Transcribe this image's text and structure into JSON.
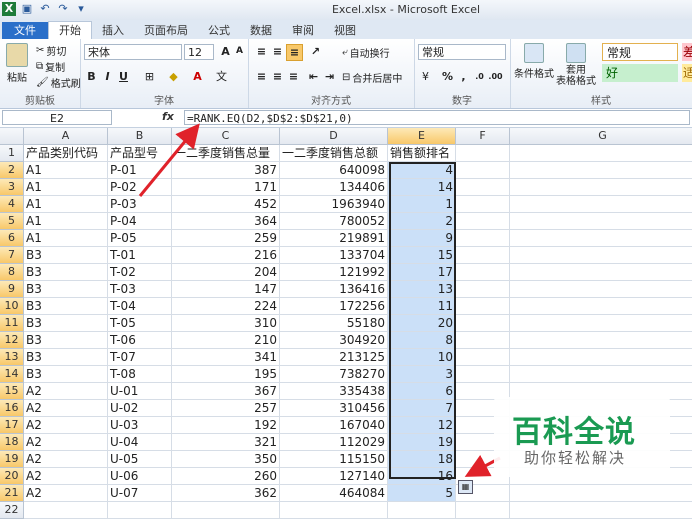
{
  "window": {
    "title": "Excel.xlsx - Microsoft Excel"
  },
  "tabs": [
    "文件",
    "开始",
    "插入",
    "页面布局",
    "公式",
    "数据",
    "审阅",
    "视图"
  ],
  "ribbon": {
    "clipboard": {
      "paste": "粘贴",
      "cut": "剪切",
      "copy": "复制",
      "format_painter": "格式刷",
      "label": "剪贴板"
    },
    "font": {
      "name": "宋体",
      "size": "12",
      "label": "字体",
      "bold": "B",
      "italic": "I",
      "underline": "U"
    },
    "alignment": {
      "wrap": "自动换行",
      "merge": "合并后居中",
      "label": "对齐方式"
    },
    "number": {
      "format": "常规",
      "percent": "%",
      "comma": ",",
      "label": "数字"
    },
    "styles": {
      "conditional": "条件格式",
      "table": "套用\n表格格式",
      "normal": "常规",
      "good": "好",
      "bad": "差",
      "neutral": "适",
      "label": "样式"
    }
  },
  "formula_bar": {
    "name_box": "E2",
    "fx": "fx",
    "formula": "=RANK.EQ(D2,$D$2:$D$21,0)"
  },
  "columns": [
    "A",
    "B",
    "C",
    "D",
    "E",
    "F",
    "G"
  ],
  "headers": [
    "产品类别代码",
    "产品型号",
    "一二季度销售总量",
    "一二季度销售总额",
    "销售额排名"
  ],
  "rows": [
    [
      "A1",
      "P-01",
      "387",
      "640098",
      "4"
    ],
    [
      "A1",
      "P-02",
      "171",
      "134406",
      "14"
    ],
    [
      "A1",
      "P-03",
      "452",
      "1963940",
      "1"
    ],
    [
      "A1",
      "P-04",
      "364",
      "780052",
      "2"
    ],
    [
      "A1",
      "P-05",
      "259",
      "219891",
      "9"
    ],
    [
      "B3",
      "T-01",
      "216",
      "133704",
      "15"
    ],
    [
      "B3",
      "T-02",
      "204",
      "121992",
      "17"
    ],
    [
      "B3",
      "T-03",
      "147",
      "136416",
      "13"
    ],
    [
      "B3",
      "T-04",
      "224",
      "172256",
      "11"
    ],
    [
      "B3",
      "T-05",
      "310",
      "55180",
      "20"
    ],
    [
      "B3",
      "T-06",
      "210",
      "304920",
      "8"
    ],
    [
      "B3",
      "T-07",
      "341",
      "213125",
      "10"
    ],
    [
      "B3",
      "T-08",
      "195",
      "738270",
      "3"
    ],
    [
      "A2",
      "U-01",
      "367",
      "335438",
      "6"
    ],
    [
      "A2",
      "U-02",
      "257",
      "310456",
      "7"
    ],
    [
      "A2",
      "U-03",
      "192",
      "167040",
      "12"
    ],
    [
      "A2",
      "U-04",
      "321",
      "112029",
      "19"
    ],
    [
      "A2",
      "U-05",
      "350",
      "115150",
      "18"
    ],
    [
      "A2",
      "U-06",
      "260",
      "127140",
      "16"
    ],
    [
      "A2",
      "U-07",
      "362",
      "464084",
      "5"
    ]
  ],
  "watermark": {
    "title": "百科全说",
    "subtitle": "助你轻松解决"
  },
  "colors": {
    "accent": "#2a6fc9",
    "selection": "#cbe0f8",
    "arrow": "#e0222a",
    "watermark": "#1a9a52"
  }
}
